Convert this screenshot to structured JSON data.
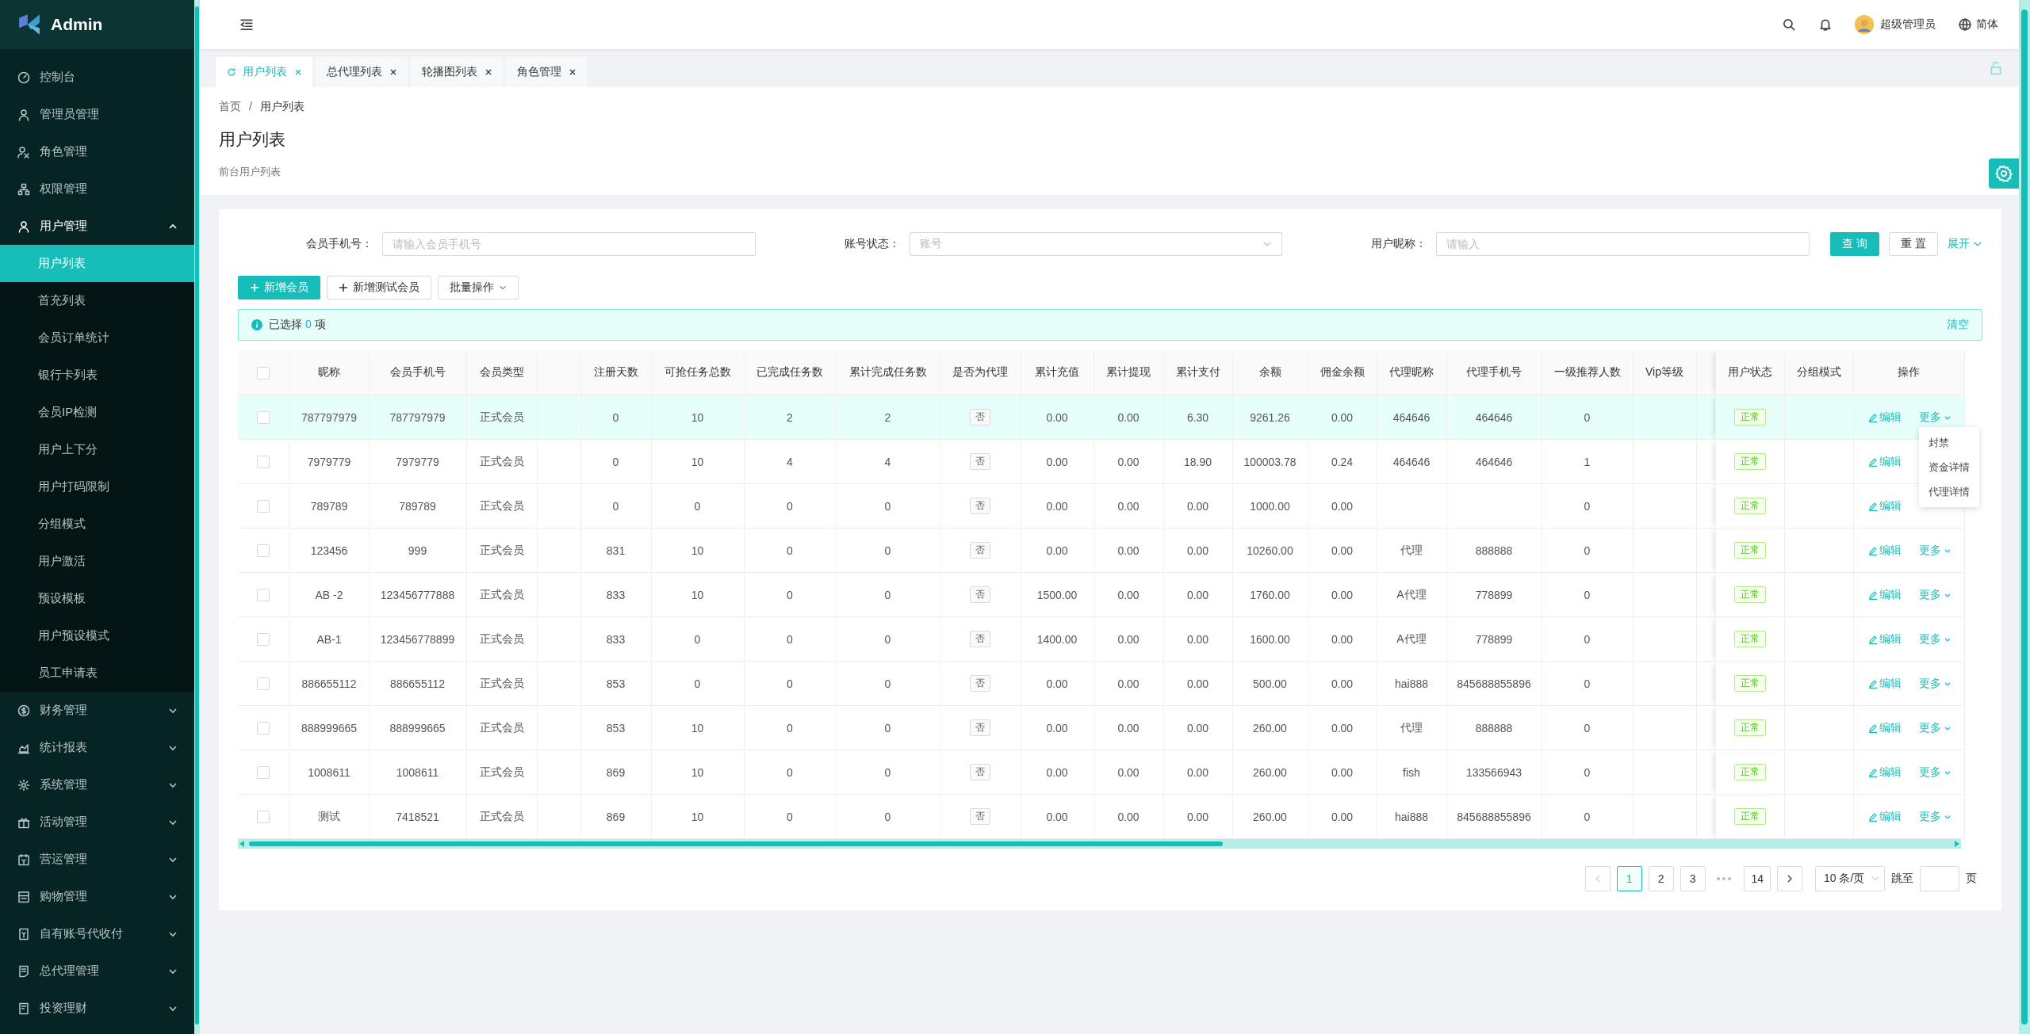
{
  "sidebar": {
    "logo_text": "Admin",
    "items": [
      {
        "label": "控制台",
        "selected": false
      },
      {
        "label": "管理员管理",
        "selected": false
      },
      {
        "label": "角色管理",
        "selected": false
      },
      {
        "label": "权限管理",
        "selected": false
      },
      {
        "label": "用户管理",
        "selected": true,
        "expanded": true,
        "children": [
          {
            "label": "用户列表",
            "selected": true
          },
          {
            "label": "首充列表",
            "selected": false
          },
          {
            "label": "会员订单统计",
            "selected": false
          },
          {
            "label": "银行卡列表",
            "selected": false
          },
          {
            "label": "会员IP检测",
            "selected": false
          },
          {
            "label": "用户上下分",
            "selected": false
          },
          {
            "label": "用户打码限制",
            "selected": false
          },
          {
            "label": "分组模式",
            "selected": false
          },
          {
            "label": "用户激活",
            "selected": false
          },
          {
            "label": "预设模板",
            "selected": false
          },
          {
            "label": "用户预设模式",
            "selected": false
          },
          {
            "label": "员工申请表",
            "selected": false
          }
        ]
      },
      {
        "label": "财务管理",
        "selected": false,
        "expanded": false
      },
      {
        "label": "统计报表",
        "selected": false,
        "expanded": false
      },
      {
        "label": "系统管理",
        "selected": false,
        "expanded": false
      },
      {
        "label": "活动管理",
        "selected": false,
        "expanded": false
      },
      {
        "label": "营运管理",
        "selected": false,
        "expanded": false
      },
      {
        "label": "购物管理",
        "selected": false,
        "expanded": false
      },
      {
        "label": "自有账号代收付",
        "selected": false,
        "expanded": false
      },
      {
        "label": "总代理管理",
        "selected": false,
        "expanded": false
      },
      {
        "label": "投资理财",
        "selected": false,
        "expanded": false
      }
    ]
  },
  "header": {
    "user_name": "超级管理员",
    "language": "简体"
  },
  "tabs": [
    {
      "label": "用户列表",
      "selected": true
    },
    {
      "label": "总代理列表",
      "selected": false
    },
    {
      "label": "轮播图列表",
      "selected": false
    },
    {
      "label": "角色管理",
      "selected": false
    }
  ],
  "breadcrumb": {
    "items": [
      "首页",
      "用户列表"
    ],
    "separator": "/"
  },
  "page_title": "用户列表",
  "page_subtitle": "前台用户列表",
  "filters": [
    {
      "label": "会员手机号：",
      "kind": "input",
      "placeholder": "请输入会员手机号"
    },
    {
      "label": "账号状态：",
      "kind": "select",
      "placeholder": "账号"
    },
    {
      "label": "用户昵称：",
      "kind": "input",
      "placeholder": "请输入"
    }
  ],
  "filter_buttons": {
    "search": "查 询",
    "reset": "重 置",
    "expand": "展开"
  },
  "actions": [
    {
      "label": "新增会员",
      "kind": "primary"
    },
    {
      "label": "新增测试会员",
      "kind": "add"
    },
    {
      "label": "批量操作",
      "kind": "dropdown"
    }
  ],
  "selection_alert": {
    "prefix": "已选择",
    "count": "0",
    "suffix": "项",
    "clear": "清空"
  },
  "table": {
    "select_all_checked": false,
    "columns": [
      "昵称",
      "会员手机号",
      "会员类型",
      "注册天数",
      "可抢任务总数",
      "已完成任务数",
      "累计完成任务数",
      "是否为代理",
      "累计充值",
      "累计提现",
      "累计支付",
      "余额",
      "佣金余额",
      "代理昵称",
      "代理手机号",
      "一级推荐人数",
      "Vip等级"
    ],
    "fixed_columns": [
      "用户状态",
      "分组模式",
      "操作"
    ],
    "rows": [
      {
        "checked": false,
        "hovered": true,
        "nickname": "787797979",
        "phone": "787797979",
        "type": "正式会员",
        "days": "0",
        "tasks_total": "10",
        "tasks_done": "2",
        "tasks_cumulative": "2",
        "is_agent": "否",
        "recharge": "0.00",
        "withdraw": "0.00",
        "paid": "6.30",
        "balance": "9261.26",
        "commission": "0.00",
        "agent_name": "464646",
        "agent_phone": "464646",
        "referrals": "0",
        "status": "正常",
        "edit": "编辑",
        "more": "更多",
        "menu": [
          "封禁",
          "资金详情",
          "代理详情"
        ]
      },
      {
        "checked": false,
        "hovered": false,
        "nickname": "7979779",
        "phone": "7979779",
        "type": "正式会员",
        "days": "0",
        "tasks_total": "10",
        "tasks_done": "4",
        "tasks_cumulative": "4",
        "is_agent": "否",
        "recharge": "0.00",
        "withdraw": "0.00",
        "paid": "18.90",
        "balance": "100003.78",
        "commission": "0.24",
        "agent_name": "464646",
        "agent_phone": "464646",
        "referrals": "1",
        "status": "正常",
        "edit": "编辑"
      },
      {
        "checked": false,
        "hovered": false,
        "nickname": "789789",
        "phone": "789789",
        "type": "正式会员",
        "days": "0",
        "tasks_total": "0",
        "tasks_done": "0",
        "tasks_cumulative": "0",
        "is_agent": "否",
        "recharge": "0.00",
        "withdraw": "0.00",
        "paid": "0.00",
        "balance": "1000.00",
        "commission": "0.00",
        "referrals": "0",
        "status": "正常",
        "edit": "编辑"
      },
      {
        "checked": false,
        "hovered": false,
        "nickname": "123456",
        "phone": "999",
        "type": "正式会员",
        "days": "831",
        "tasks_total": "10",
        "tasks_done": "0",
        "tasks_cumulative": "0",
        "is_agent": "否",
        "recharge": "0.00",
        "withdraw": "0.00",
        "paid": "0.00",
        "balance": "10260.00",
        "commission": "0.00",
        "agent_name": "代理",
        "agent_phone": "888888",
        "referrals": "0",
        "status": "正常",
        "edit": "编辑",
        "more": "更多"
      },
      {
        "checked": false,
        "hovered": false,
        "nickname": "AB -2",
        "phone": "123456777888",
        "type": "正式会员",
        "days": "833",
        "tasks_total": "10",
        "tasks_done": "0",
        "tasks_cumulative": "0",
        "is_agent": "否",
        "recharge": "1500.00",
        "withdraw": "0.00",
        "paid": "0.00",
        "balance": "1760.00",
        "commission": "0.00",
        "agent_name": "A代理",
        "agent_phone": "778899",
        "referrals": "0",
        "status": "正常",
        "edit": "编辑",
        "more": "更多"
      },
      {
        "checked": false,
        "hovered": false,
        "nickname": "AB-1",
        "phone": "123456778899",
        "type": "正式会员",
        "days": "833",
        "tasks_total": "0",
        "tasks_done": "0",
        "tasks_cumulative": "0",
        "is_agent": "否",
        "recharge": "1400.00",
        "withdraw": "0.00",
        "paid": "0.00",
        "balance": "1600.00",
        "commission": "0.00",
        "agent_name": "A代理",
        "agent_phone": "778899",
        "referrals": "0",
        "status": "正常",
        "edit": "编辑",
        "more": "更多"
      },
      {
        "checked": false,
        "hovered": false,
        "nickname": "886655112",
        "phone": "886655112",
        "type": "正式会员",
        "days": "853",
        "tasks_total": "0",
        "tasks_done": "0",
        "tasks_cumulative": "0",
        "is_agent": "否",
        "recharge": "0.00",
        "withdraw": "0.00",
        "paid": "0.00",
        "balance": "500.00",
        "commission": "0.00",
        "agent_name": "hai888",
        "agent_phone": "845688855896",
        "referrals": "0",
        "status": "正常",
        "edit": "编辑",
        "more": "更多"
      },
      {
        "checked": false,
        "hovered": false,
        "nickname": "888999665",
        "phone": "888999665",
        "type": "正式会员",
        "days": "853",
        "tasks_total": "10",
        "tasks_done": "0",
        "tasks_cumulative": "0",
        "is_agent": "否",
        "recharge": "0.00",
        "withdraw": "0.00",
        "paid": "0.00",
        "balance": "260.00",
        "commission": "0.00",
        "agent_name": "代理",
        "agent_phone": "888888",
        "referrals": "0",
        "status": "正常",
        "edit": "编辑",
        "more": "更多"
      },
      {
        "checked": false,
        "hovered": false,
        "nickname": "1008611",
        "phone": "1008611",
        "type": "正式会员",
        "days": "869",
        "tasks_total": "10",
        "tasks_done": "0",
        "tasks_cumulative": "0",
        "is_agent": "否",
        "recharge": "0.00",
        "withdraw": "0.00",
        "paid": "0.00",
        "balance": "260.00",
        "commission": "0.00",
        "agent_name": "fish",
        "agent_phone": "133566943",
        "referrals": "0",
        "status": "正常",
        "edit": "编辑",
        "more": "更多"
      },
      {
        "checked": false,
        "hovered": false,
        "nickname": "测试",
        "phone": "7418521",
        "type": "正式会员",
        "days": "869",
        "tasks_total": "10",
        "tasks_done": "0",
        "tasks_cumulative": "0",
        "is_agent": "否",
        "recharge": "0.00",
        "withdraw": "0.00",
        "paid": "0.00",
        "balance": "260.00",
        "commission": "0.00",
        "agent_name": "hai888",
        "agent_phone": "845688855896",
        "referrals": "0",
        "status": "正常",
        "edit": "编辑",
        "more": "更多"
      }
    ]
  },
  "pagination": {
    "prev_disabled": true,
    "next_disabled": false,
    "pages": [
      {
        "label": "1",
        "selected": true
      },
      {
        "label": "2",
        "selected": false
      },
      {
        "label": "3",
        "selected": false
      },
      {
        "label": "•••",
        "kind": "ellipsis"
      },
      {
        "label": "14",
        "selected": false
      }
    ],
    "page_size": "10 条/页",
    "jump_label": "跳至",
    "page_unit": "页"
  }
}
